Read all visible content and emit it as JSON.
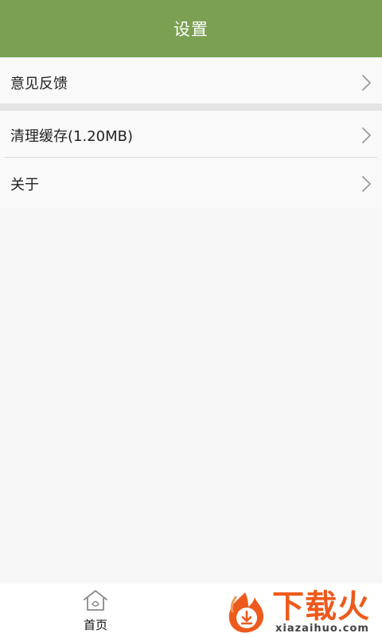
{
  "header": {
    "title": "设置"
  },
  "settings": {
    "items": [
      {
        "label": "意见反馈"
      },
      {
        "label": "清理缓存(1.20MB)"
      },
      {
        "label": "关于"
      }
    ]
  },
  "bottom_nav": {
    "home_label": "首页"
  },
  "watermark": {
    "brand": "下载火",
    "domain": "xiazaihuo.com"
  },
  "colors": {
    "header_bg": "#7ba052",
    "page_bg": "#f7f7f7",
    "watermark_orange": "#ee5a1d"
  },
  "icons": {
    "row_arrow": "chevron-right-icon",
    "home": "home-icon"
  }
}
